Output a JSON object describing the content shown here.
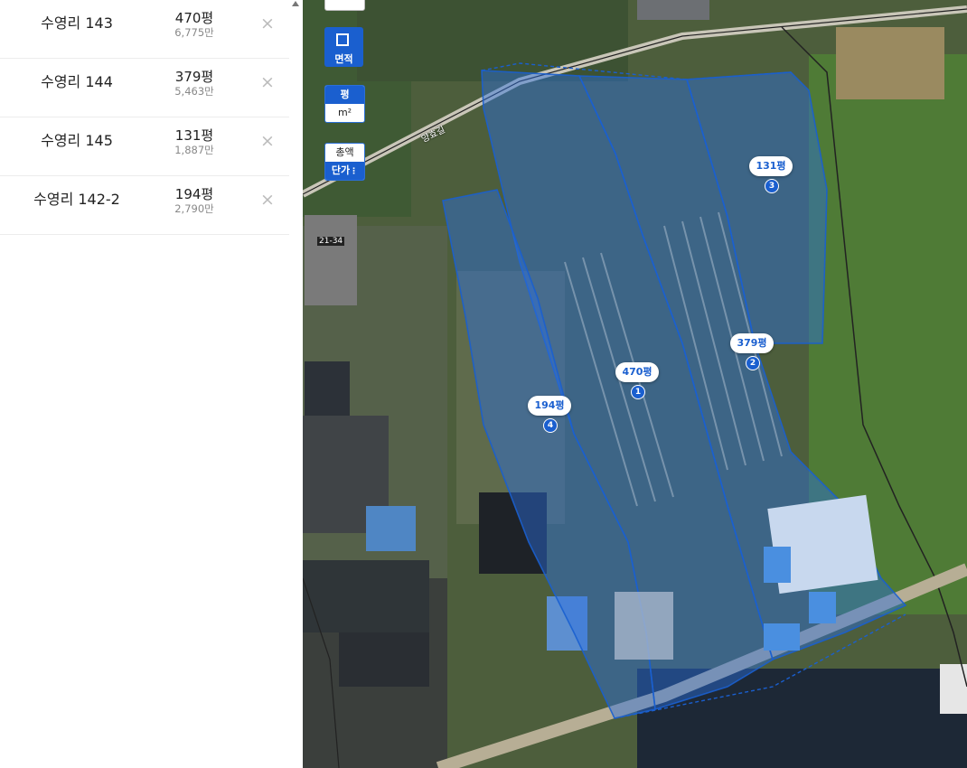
{
  "list": [
    {
      "name": "수영리 143",
      "area": "470평",
      "price": "6,775만"
    },
    {
      "name": "수영리 144",
      "area": "379평",
      "price": "5,463만"
    },
    {
      "name": "수영리 145",
      "area": "131평",
      "price": "1,887만"
    },
    {
      "name": "수영리 142-2",
      "area": "194평",
      "price": "2,790만"
    }
  ],
  "delete_icon": "×",
  "controls": {
    "area_tool": "면적",
    "unit_pyeong": "평",
    "unit_sqm": "m²",
    "total": "총액",
    "unit_price": "단가"
  },
  "parcels": [
    {
      "label": "470평",
      "num": "1"
    },
    {
      "label": "379평",
      "num": "2"
    },
    {
      "label": "131평",
      "num": "3"
    },
    {
      "label": "194평",
      "num": "4"
    }
  ],
  "road_label": "양효길",
  "building_tag": "21-34",
  "colors": {
    "accent": "#1a5fcf",
    "parcel_fill": "#2a6fe0"
  }
}
